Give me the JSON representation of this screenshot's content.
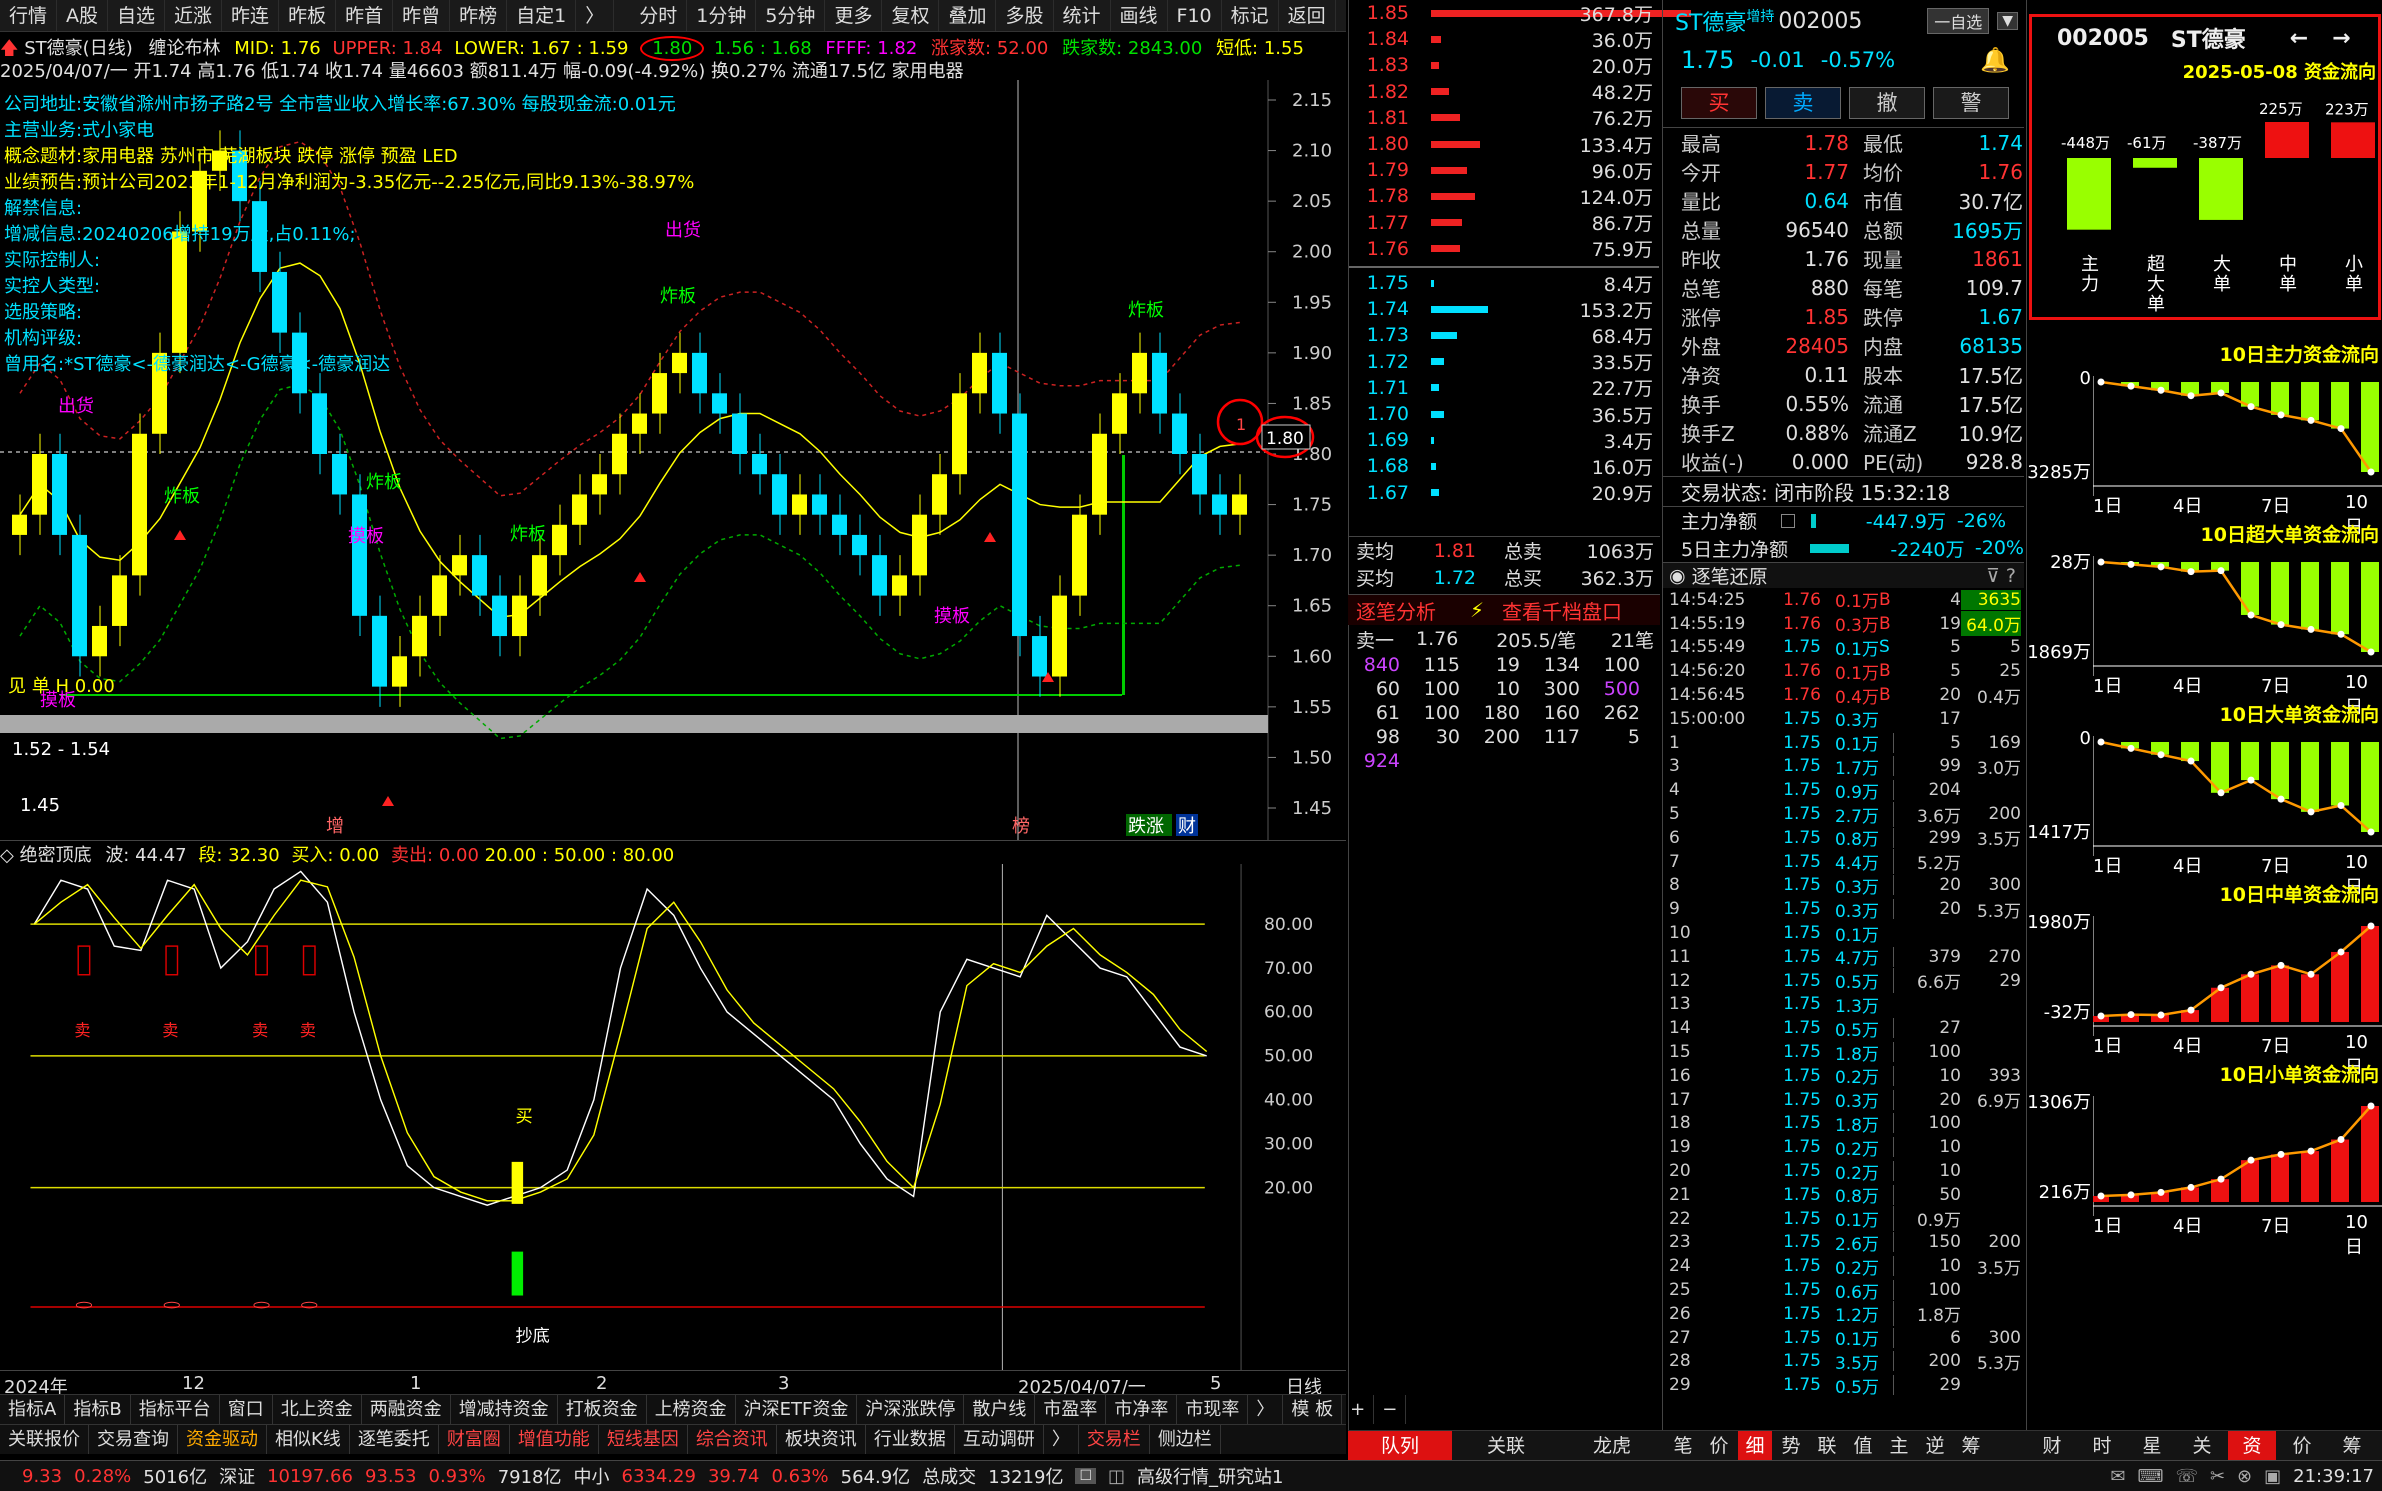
{
  "topbar": {
    "items": [
      "行情",
      "A股",
      "自选",
      "近涨",
      "昨连",
      "昨板",
      "昨首",
      "昨曾",
      "昨榜",
      "自定1",
      "〉",
      "分时",
      "1分钟",
      "5分钟",
      "更多",
      "复权",
      "叠加",
      "多股",
      "统计",
      "画线",
      "F10",
      "标记",
      "返回"
    ]
  },
  "kline": {
    "title": "ST德豪(日线)",
    "indicator": "缠论布林",
    "mid": "MID: 1.76",
    "upper": "UPPER: 1.84",
    "lower": "LOWER: 1.67 : 1.59",
    "circled_value": "1.80",
    "v1": "1.56 : 1.68",
    "ffff": "FFFF: 1.82",
    "up_count": "涨家数: 52.00",
    "down_count": "跌家数: 2843.00",
    "short": "短低: 1.55",
    "info2": "2025/04/07/一 开1.74 高1.76 低1.74 收1.74 量46603 额811.4万 幅-0.09(-4.92%) 换0.27% 流通17.5亿 家用电器",
    "annotations": [
      {
        "text": "公司地址:安徽省滁州市扬子路2号 全市营业收入增长率:67.30% 每股现金流:0.01元",
        "color": "#00e0ff"
      },
      {
        "text": "主营业务:式小家电",
        "color": "#00e0ff"
      },
      {
        "text": "概念题材:家用电器 苏州市 芜湖板块 跌停 涨停 预盈 LED",
        "color": "#ffff00"
      },
      {
        "text": "业绩预告:预计公司2023年1-12月净利润为-3.35亿元--2.25亿元,同比9.13%-38.97%",
        "color": "#ffff00"
      },
      {
        "text": "解禁信息:",
        "color": "#00e0ff"
      },
      {
        "text": "增减信息:20240206增持19万股,占0.11%;",
        "color": "#00e0ff"
      },
      {
        "text": "",
        "color": "#00e0ff"
      },
      {
        "text": "实际控制人:",
        "color": "#00e0ff"
      },
      {
        "text": "实控人类型:",
        "color": "#00e0ff"
      },
      {
        "text": "选股策略:",
        "color": "#00e0ff"
      },
      {
        "text": "机构评级:",
        "color": "#00e0ff"
      },
      {
        "text": "曾用名:*ST德豪<-德豪润达<-G德豪<-德豪润达",
        "color": "#00e0ff"
      }
    ],
    "labels": {
      "chuhuo": "出货",
      "chuhuo2": "出货",
      "zhaban": "炸板",
      "zhaban_small": "炸板",
      "juban": "摸板",
      "range": "1.52 - 1.54",
      "low": "1.45",
      "circle_num": "1",
      "price_tag": "1.80",
      "hint": "见 单 H 0.00",
      "zeng": "增",
      "bang": "榜",
      "diezhang": "跌涨",
      "cai": "财"
    },
    "yticks": [
      "2.15",
      "2.10",
      "2.05",
      "2.00",
      "1.95",
      "1.90",
      "1.85",
      "1.80",
      "1.75",
      "1.70",
      "1.65",
      "1.60",
      "1.55",
      "1.50",
      "1.45"
    ]
  },
  "chart_data": {
    "type": "candlestick",
    "title": "ST德豪(日线)",
    "series": [
      {
        "name": "K线",
        "close": [
          1.74,
          1.8,
          1.72,
          1.6,
          1.63,
          1.68,
          1.82,
          1.9,
          2.02,
          2.08,
          2.1,
          2.05,
          1.98,
          1.92,
          1.86,
          1.8,
          1.76,
          1.64,
          1.57,
          1.6,
          1.64,
          1.68,
          1.7,
          1.66,
          1.62,
          1.66,
          1.7,
          1.73,
          1.76,
          1.78,
          1.82,
          1.84,
          1.88,
          1.9,
          1.86,
          1.84,
          1.8,
          1.78,
          1.74,
          1.76,
          1.74,
          1.72,
          1.7,
          1.66,
          1.68,
          1.74,
          1.78,
          1.86,
          1.9,
          1.84,
          1.62,
          1.58,
          1.66,
          1.74,
          1.82,
          1.86,
          1.9,
          1.84,
          1.8,
          1.76,
          1.74,
          1.76
        ]
      }
    ],
    "ylim": [
      1.45,
      2.15
    ]
  },
  "indicator": {
    "name": "绝密顶底",
    "wave": "波: 44.47",
    "seg": "段: 32.30",
    "buy": "买入: 0.00",
    "sell": "卖出: 0.00",
    "levels": "20.00 : 50.00 : 80.00",
    "yticks": [
      "80.00",
      "70.00",
      "60.00",
      "50.00",
      "40.00",
      "30.00",
      "20.00"
    ],
    "sell_label": "卖",
    "buy_label": "买",
    "bottom_label": "抄底"
  },
  "xaxis": {
    "labels": [
      "2024年",
      "12",
      "1",
      "2",
      "3",
      "4",
      "2025/04/07/一",
      "5"
    ],
    "period": "日线"
  },
  "tabs1": [
    "指标A",
    "指标B",
    "指标平台",
    "窗口",
    "北上资金",
    "两融资金",
    "增减持资金",
    "打板资金",
    "上榜资金",
    "沪深ETF资金",
    "沪深涨跌停",
    "散户线",
    "市盈率",
    "市净率",
    "市现率",
    "〉",
    "模 板",
    "+",
    "−"
  ],
  "tabs2": [
    "关联报价",
    "交易查询",
    "资金驱动",
    "相似K线",
    "逐笔委托",
    "财富圈",
    "增值功能",
    "短线基因",
    "综合资讯",
    "板块资讯",
    "行业数据",
    "互动调研",
    "〉",
    "交易栏",
    "侧边栏"
  ],
  "status": {
    "idx1": "9.33",
    "idx1pct": "0.28%",
    "idx1amt": "5016亿",
    "sz": "深证",
    "szv": "10197.66",
    "szc": "93.53",
    "szp": "0.93%",
    "sza": "7918亿",
    "zx": "中小",
    "zxv": "6334.29",
    "zxc": "39.74",
    "zxp": "0.63%",
    "zxa": "564.9亿",
    "total": "总成交",
    "totalv": "13219亿",
    "site": "高级行情_研究站1",
    "time": "21:39:17"
  },
  "book": {
    "asks": [
      [
        "1.85",
        "367.8万"
      ],
      [
        "1.84",
        "36.0万"
      ],
      [
        "1.83",
        "20.0万"
      ],
      [
        "1.82",
        "48.2万"
      ],
      [
        "1.81",
        "76.2万"
      ],
      [
        "1.80",
        "133.4万"
      ],
      [
        "1.79",
        "96.0万"
      ],
      [
        "1.78",
        "124.0万"
      ],
      [
        "1.77",
        "86.7万"
      ],
      [
        "1.76",
        "75.9万"
      ]
    ],
    "bids": [
      [
        "1.75",
        "8.4万"
      ],
      [
        "1.74",
        "153.2万"
      ],
      [
        "1.73",
        "68.4万"
      ],
      [
        "1.72",
        "33.5万"
      ],
      [
        "1.71",
        "22.7万"
      ],
      [
        "1.70",
        "36.5万"
      ],
      [
        "1.69",
        "3.4万"
      ],
      [
        "1.68",
        "16.0万"
      ],
      [
        "1.67",
        "20.9万"
      ]
    ],
    "ask_bar": [
      100,
      4,
      3,
      7,
      11,
      19,
      14,
      17,
      12,
      11
    ],
    "bid_bar": [
      1,
      22,
      10,
      5,
      3,
      5,
      1,
      2,
      3
    ],
    "sell_avg_l": "卖均",
    "sell_avg": "1.81",
    "total_sell_l": "总卖",
    "total_sell": "1063万",
    "buy_avg_l": "买均",
    "buy_avg": "1.72",
    "total_buy_l": "总买",
    "total_buy": "362.3万",
    "analysis": "逐笔分析",
    "depth": "查看千档盘口",
    "ask1_l": "卖一",
    "ask1_p": "1.76",
    "ask1_v": "205.5/笔",
    "ask1_n": "21笔",
    "queue": [
      [
        "840",
        "115",
        "19",
        "134",
        "100"
      ],
      [
        "60",
        "100",
        "10",
        "300",
        "500"
      ],
      [
        "61",
        "100",
        "180",
        "160",
        "262"
      ],
      [
        "98",
        "30",
        "200",
        "117",
        "5"
      ],
      [
        "924",
        "",
        "",
        "",
        ""
      ]
    ]
  },
  "quote": {
    "name": "ST德豪",
    "tag": "增持",
    "code": "002005",
    "watch": "一自选",
    "price": "1.75",
    "chg": "-0.01",
    "pct": "-0.57%",
    "buttons": [
      "买",
      "卖",
      "撤",
      "警"
    ],
    "rows": [
      [
        "最高",
        "1.78",
        "最低",
        "1.74"
      ],
      [
        "今开",
        "1.77",
        "均价",
        "1.76"
      ],
      [
        "量比",
        "0.64",
        "市值",
        "30.7亿"
      ],
      [
        "总量",
        "96540",
        "总额",
        "1695万"
      ],
      [
        "昨收",
        "1.76",
        "现量",
        "1861"
      ],
      [
        "总笔",
        "880",
        "每笔",
        "109.7"
      ],
      [
        "涨停",
        "1.85",
        "跌停",
        "1.67"
      ],
      [
        "外盘",
        "28405",
        "内盘",
        "68135"
      ],
      [
        "净资",
        "0.11",
        "股本",
        "17.5亿"
      ],
      [
        "换手",
        "0.55%",
        "流通",
        "17.5亿"
      ],
      [
        "换手Z",
        "0.88%",
        "流通Z",
        "10.9亿"
      ],
      [
        "收益(-)",
        "0.000",
        "PE(动)",
        "928.8"
      ]
    ],
    "state": "交易状态: 闭市阶段 15:32:18",
    "flow1_l": "主力净额",
    "flow1_v": "-447.9万",
    "flow1_p": "-26%",
    "flow5_l": "5日主力净额",
    "flow5_v": "-2240万",
    "flow5_p": "-20%",
    "tick_title": "逐笔还原",
    "ticks": [
      [
        "14:54:25",
        "1.76",
        "0.1万",
        "B",
        "4",
        "3635"
      ],
      [
        "14:55:19",
        "1.76",
        "0.3万",
        "B",
        "19",
        "64.0万"
      ],
      [
        "14:55:49",
        "1.75",
        "0.1万",
        "S",
        "5",
        "5"
      ],
      [
        "14:56:20",
        "1.76",
        "0.1万",
        "B",
        "5",
        "25"
      ],
      [
        "14:56:45",
        "1.76",
        "0.4万",
        "B",
        "20",
        "0.4万"
      ],
      [
        "15:00:00",
        "1.75",
        "0.3万",
        "",
        "17",
        ""
      ],
      [
        "1",
        "1.75",
        "0.1万",
        "",
        "5",
        "169"
      ],
      [
        "3",
        "1.75",
        "1.7万",
        "",
        "99",
        "3.0万"
      ],
      [
        "4",
        "1.75",
        "0.9万",
        "",
        "204",
        ""
      ],
      [
        "5",
        "1.75",
        "2.7万",
        "",
        "3.6万",
        "200"
      ],
      [
        "6",
        "1.75",
        "0.8万",
        "",
        "299",
        "3.5万"
      ],
      [
        "7",
        "1.75",
        "4.4万",
        "",
        "5.2万",
        ""
      ],
      [
        "8",
        "1.75",
        "0.3万",
        "",
        "20",
        "300"
      ],
      [
        "9",
        "1.75",
        "0.3万",
        "",
        "20",
        "5.3万"
      ],
      [
        "10",
        "1.75",
        "0.1万",
        "",
        "",
        ""
      ],
      [
        "11",
        "1.75",
        "4.7万",
        "",
        "379",
        "270"
      ],
      [
        "12",
        "1.75",
        "0.5万",
        "",
        "6.6万",
        "29"
      ],
      [
        "13",
        "1.75",
        "1.3万",
        "",
        "",
        ""
      ],
      [
        "14",
        "1.75",
        "0.5万",
        "",
        "27",
        ""
      ],
      [
        "15",
        "1.75",
        "1.8万",
        "",
        "100",
        ""
      ],
      [
        "16",
        "1.75",
        "0.2万",
        "",
        "10",
        "393"
      ],
      [
        "17",
        "1.75",
        "0.3万",
        "",
        "20",
        "6.9万"
      ],
      [
        "18",
        "1.75",
        "1.8万",
        "",
        "100",
        ""
      ],
      [
        "19",
        "1.75",
        "0.2万",
        "",
        "10",
        ""
      ],
      [
        "20",
        "1.75",
        "0.2万",
        "",
        "10",
        ""
      ],
      [
        "21",
        "1.75",
        "0.8万",
        "",
        "50",
        ""
      ],
      [
        "22",
        "1.75",
        "0.1万",
        "",
        "0.9万",
        ""
      ],
      [
        "23",
        "1.75",
        "2.6万",
        "",
        "150",
        "200"
      ],
      [
        "24",
        "1.75",
        "0.2万",
        "",
        "10",
        "3.5万"
      ],
      [
        "25",
        "1.75",
        "0.6万",
        "",
        "100",
        ""
      ],
      [
        "26",
        "1.75",
        "1.2万",
        "",
        "1.8万",
        ""
      ],
      [
        "27",
        "1.75",
        "0.1万",
        "",
        "6",
        "300"
      ],
      [
        "28",
        "1.75",
        "3.5万",
        "",
        "200",
        "5.3万"
      ],
      [
        "29",
        "1.75",
        "0.5万",
        "",
        "29",
        ""
      ]
    ]
  },
  "fundflow": {
    "code": "002005",
    "name": "ST德豪",
    "date": "2025-05-08 资金流向",
    "bars": [
      {
        "label": "主力",
        "value": "-448万"
      },
      {
        "label": "超大单",
        "value": "-61万"
      },
      {
        "label": "大单",
        "value": "-387万"
      },
      {
        "label": "中单",
        "value": "225万"
      },
      {
        "label": "小单",
        "value": "223万"
      }
    ],
    "panels": [
      {
        "title": "10日主力资金流向",
        "top": "0",
        "bottom": "3285万",
        "line": [
          0,
          -150,
          -300,
          -500,
          -400,
          -900,
          -1200,
          -1400,
          -1700,
          -3285
        ],
        "color": "#99ff00"
      },
      {
        "title": "10日超大单资金流向",
        "top": "28万",
        "bottom": "1869万",
        "line": [
          0,
          -50,
          -100,
          -200,
          -180,
          -1100,
          -1300,
          -1400,
          -1500,
          -1869
        ],
        "color": "#99ff00"
      },
      {
        "title": "10日大单资金流向",
        "top": "0",
        "bottom": "1417万",
        "line": [
          0,
          -100,
          -200,
          -300,
          -800,
          -600,
          -900,
          -1100,
          -1000,
          -1417
        ],
        "color": "#99ff00"
      },
      {
        "title": "10日中单资金流向",
        "top": "1980万",
        "bottom": "-32万",
        "line": [
          -32,
          0,
          -10,
          100,
          600,
          900,
          1100,
          900,
          1400,
          1980
        ],
        "color": "#ee1111"
      },
      {
        "title": "10日小单资金流向",
        "top": "1306万",
        "bottom": "216万",
        "line": [
          216,
          230,
          260,
          320,
          420,
          650,
          720,
          760,
          900,
          1306
        ],
        "color": "#ee1111"
      }
    ],
    "xlabels": [
      "1日",
      "4日",
      "7日",
      "10日"
    ]
  },
  "rtabs": {
    "left": [
      "队列",
      "关联",
      "龙虎"
    ],
    "mid": [
      "笔",
      "价",
      "细",
      "势",
      "联",
      "值",
      "主",
      "逆",
      "筹"
    ],
    "right": [
      "财",
      "时",
      "星",
      "关",
      "资",
      "价",
      "筹"
    ]
  }
}
